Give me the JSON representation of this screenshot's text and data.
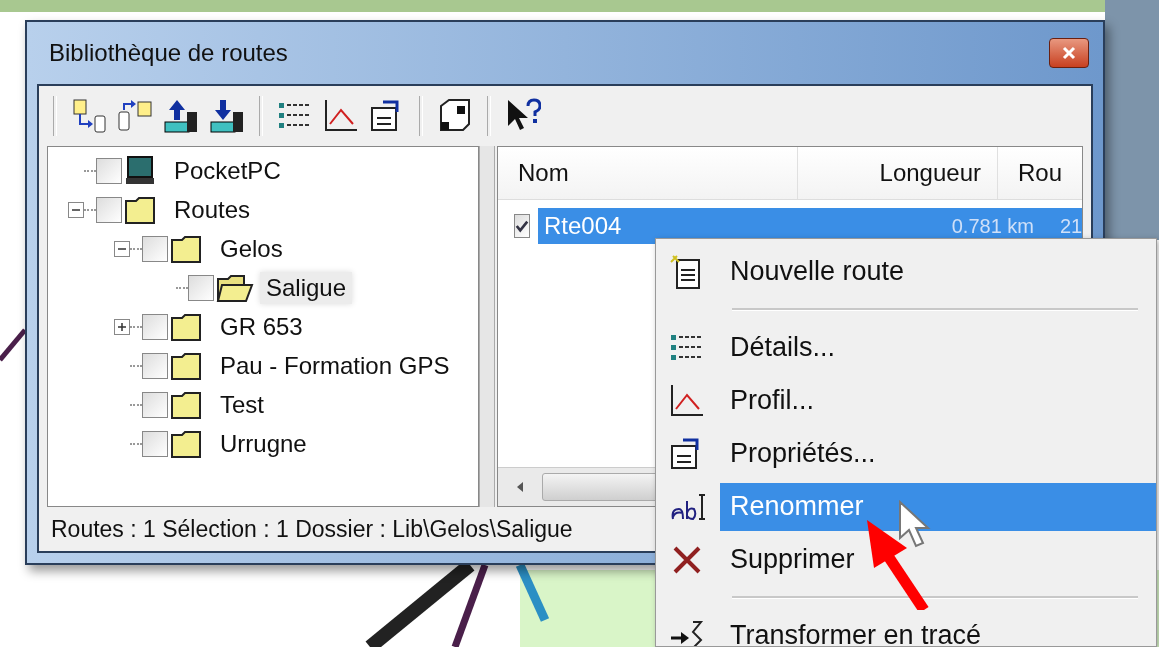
{
  "window": {
    "title": "Bibliothèque de routes"
  },
  "tree": [
    {
      "kind": "device",
      "label": "PocketPC",
      "checked": false,
      "selected": false
    },
    {
      "kind": "folder",
      "label": "Routes",
      "checked": false,
      "selected": false,
      "expanded": true,
      "children": [
        {
          "kind": "folder",
          "label": "Gelos",
          "checked": false,
          "selected": false,
          "expanded": true,
          "children": [
            {
              "kind": "open-folder",
              "label": "Saligue",
              "checked": false,
              "selected": true
            }
          ]
        },
        {
          "kind": "folder",
          "label": "GR 653",
          "checked": false,
          "selected": false,
          "expanded": false
        },
        {
          "kind": "folder",
          "label": "Pau - Formation GPS",
          "checked": false,
          "selected": false
        },
        {
          "kind": "folder",
          "label": "Test",
          "checked": false,
          "selected": false
        },
        {
          "kind": "folder",
          "label": "Urrugne",
          "checked": false,
          "selected": false
        }
      ]
    }
  ],
  "list": {
    "columns": [
      "Nom",
      "Longueur",
      "Rou"
    ],
    "rows": [
      {
        "cells": [
          "Rte004",
          "0.781 km",
          "21"
        ],
        "checked": true,
        "selected": true
      }
    ]
  },
  "status_bar": "Routes : 1 Sélection : 1 Dossier : Lib\\Gelos\\Saligue",
  "context_menu": [
    {
      "kind": "item",
      "label": "Nouvelle route",
      "selected": false
    },
    {
      "kind": "separator"
    },
    {
      "kind": "item",
      "label": "Détails...",
      "selected": false
    },
    {
      "kind": "item",
      "label": "Profil...",
      "selected": false
    },
    {
      "kind": "item",
      "label": "Propriétés...",
      "selected": false
    },
    {
      "kind": "item",
      "label": "Renommer",
      "selected": true
    },
    {
      "kind": "item",
      "label": "Supprimer",
      "selected": false
    },
    {
      "kind": "separator"
    },
    {
      "kind": "item",
      "label": "Transformer en tracé",
      "selected": false
    }
  ]
}
